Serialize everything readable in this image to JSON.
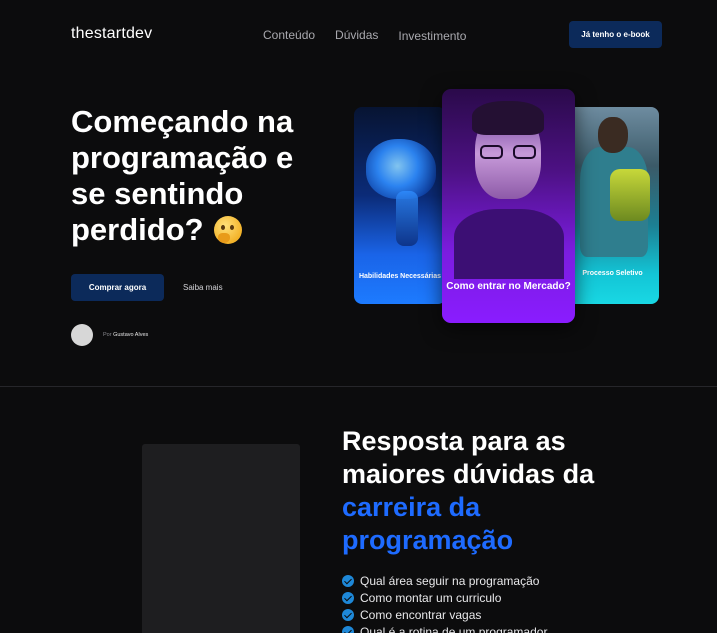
{
  "nav": {
    "logo": "thestartdev",
    "links": [
      "Conteúdo",
      "Dúvidas",
      "Investimento"
    ],
    "cta": "Já tenho o e-book"
  },
  "hero": {
    "title": "Começando na programação e se sentindo perdido?",
    "emoji": "thinking-face",
    "primary_button": "Comprar agora",
    "secondary_button": "Saiba mais",
    "author_prefix": "Por",
    "author_name": "Gustavo Alves"
  },
  "cards": [
    {
      "label": "Habilidades Necessárias",
      "image": "neon-brain"
    },
    {
      "label": "Como entrar no Mercado?",
      "image": "smiling-man-glasses"
    },
    {
      "label": "Processo Seletivo",
      "image": "student-backpack"
    }
  ],
  "section2": {
    "title_part1": "Resposta para as maiores dúvidas da",
    "title_accent": "carreira da programação",
    "items": [
      "Qual área seguir na programação",
      "Como montar um curriculo",
      "Como encontrar vagas",
      "Qual é a rotina de um programador"
    ]
  },
  "colors": {
    "background": "#0c0c0d",
    "button": "#0c2a5a",
    "accent": "#1e6bff",
    "check": "#1e88d8"
  }
}
